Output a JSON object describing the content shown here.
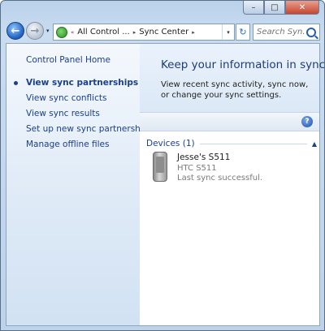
{
  "titlebar": {
    "minimize": "–",
    "maximize": "□",
    "close": "✕"
  },
  "nav": {
    "back_glyph": "←",
    "forward_glyph": "→",
    "dropdown_glyph": "▾"
  },
  "address": {
    "prefix": "«",
    "crumbs": [
      "All Control ...",
      "Sync Center"
    ],
    "separator": "▸",
    "dropdown": "▾",
    "refresh_glyph": "↻"
  },
  "search": {
    "placeholder": "Search Syn..."
  },
  "sidebar": {
    "items": [
      {
        "label": "Control Panel Home"
      },
      {
        "label": "View sync partnerships",
        "selected": true
      },
      {
        "label": "View sync conflicts"
      },
      {
        "label": "View sync results"
      },
      {
        "label": "Set up new sync partnerships"
      },
      {
        "label": "Manage offline files"
      }
    ]
  },
  "main": {
    "title": "Keep your information in sync",
    "description": "View recent sync activity, sync now, or change your sync settings.",
    "help": "?",
    "group": {
      "label": "Devices (1)",
      "chevron": "▲"
    },
    "device": {
      "name": "Jesse's S511",
      "model": "HTC S511",
      "status": "Last sync successful."
    }
  },
  "colors": {
    "link": "#1a3f8e",
    "title": "#1f3c78",
    "accent": "#1d5fbf"
  },
  "icons": [
    "back-arrow-icon",
    "forward-arrow-icon",
    "sync-center-icon",
    "refresh-icon",
    "search-icon",
    "help-icon",
    "phone-icon"
  ]
}
